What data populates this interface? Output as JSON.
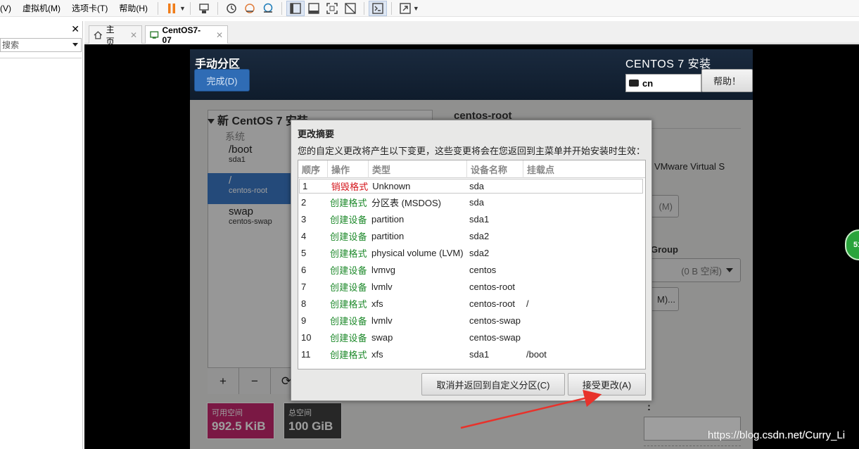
{
  "menubar": {
    "items": [
      "(V)",
      "虚拟机(M)",
      "选项卡(T)",
      "帮助(H)"
    ]
  },
  "toolbar": {
    "icons": [
      "pause-icon",
      "send-ctrl-alt-del-icon",
      "snapshot-icon",
      "revert-snapshot-icon",
      "snapshot-manager-icon",
      "library-view-icon",
      "unity-icon",
      "fullscreen-icon",
      "fit-guest-icon",
      "console-icon",
      "stretch-icon"
    ],
    "pause_color": "#f07d1a"
  },
  "library": {
    "close": "✕",
    "search_placeholder": "搜索"
  },
  "tabs": [
    {
      "label": "主页",
      "icon": "home-icon"
    },
    {
      "label": "CentOS7-07",
      "icon": "vm-icon",
      "active": true
    }
  ],
  "installer": {
    "spoke_title": "手动分区",
    "done_button": "完成(D)",
    "product_title": "CENTOS 7 安装",
    "keyboard_layout": "cn",
    "help_button": "帮助！",
    "tree_header": "新 CentOS 7 安装",
    "system_label": "系统",
    "mounts": [
      {
        "name": "/boot",
        "device": "sda1"
      },
      {
        "name": "/",
        "device": "centos-root",
        "selected": true
      },
      {
        "name": "swap",
        "device": "centos-swap"
      }
    ],
    "tree_buttons": [
      "+",
      "−",
      "⟳"
    ],
    "available_space": {
      "label": "可用空间",
      "value": "992.5 KiB",
      "color": "#c6286f"
    },
    "total_space": {
      "label": "总空间",
      "value": "100 GiB"
    },
    "device_title": "centos-root",
    "device_name": "VMware Virtual S",
    "modify_partial": "(M)",
    "vg_label": "Group",
    "vg_value": "(0 B 空闲)",
    "vg_modify_partial": "M)...",
    "label_colon": ":"
  },
  "dialog": {
    "title": "更改摘要",
    "message": "您的自定义更改将产生以下变更，这些变更将会在您返回到主菜单并开始安装时生效：",
    "columns": [
      "顺序",
      "操作",
      "类型",
      "设备名称",
      "挂载点"
    ],
    "rows": [
      [
        "1",
        "销毁格式",
        "Unknown",
        "sda",
        ""
      ],
      [
        "2",
        "创建格式",
        "分区表 (MSDOS)",
        "sda",
        ""
      ],
      [
        "3",
        "创建设备",
        "partition",
        "sda1",
        ""
      ],
      [
        "4",
        "创建设备",
        "partition",
        "sda2",
        ""
      ],
      [
        "5",
        "创建格式",
        "physical volume (LVM)",
        "sda2",
        ""
      ],
      [
        "6",
        "创建设备",
        "lvmvg",
        "centos",
        ""
      ],
      [
        "7",
        "创建设备",
        "lvmlv",
        "centos-root",
        ""
      ],
      [
        "8",
        "创建格式",
        "xfs",
        "centos-root",
        "/"
      ],
      [
        "9",
        "创建设备",
        "lvmlv",
        "centos-swap",
        ""
      ],
      [
        "10",
        "创建设备",
        "swap",
        "centos-swap",
        ""
      ],
      [
        "11",
        "创建格式",
        "xfs",
        "sda1",
        "/boot"
      ]
    ],
    "destroy_color": "#d4141a",
    "create_color": "#1f8a2c",
    "cancel_button": "取消并返回到自定义分区(C)",
    "accept_button": "接受更改(A)"
  },
  "overlay": {
    "watermark": "https://blog.csdn.net/Curry_Li",
    "badge": "51",
    "arrow_color": "#e8322b"
  }
}
